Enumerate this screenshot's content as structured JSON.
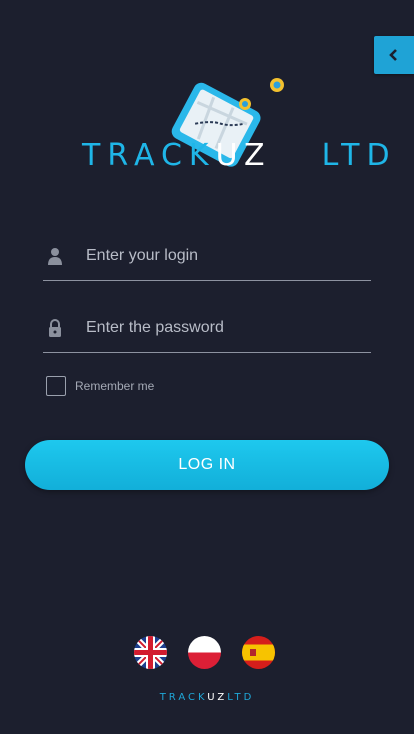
{
  "brand": {
    "logo_part1": "TRACK",
    "logo_part2": "UZ",
    "logo_part3": "LTD",
    "colors": {
      "background": "#1c1f2e",
      "accent": "#1fb6e8",
      "button": "#18bde6"
    }
  },
  "sidebar_toggle": {
    "icon": "chevron-left-icon"
  },
  "form": {
    "login_placeholder": "Enter your login",
    "password_placeholder": "Enter the password",
    "login_icon": "user-icon",
    "password_icon": "lock-icon",
    "remember_label": "Remember me",
    "remember_checked": false,
    "submit_label": "LOG IN"
  },
  "languages": [
    {
      "code": "en",
      "icon": "uk-flag-icon"
    },
    {
      "code": "pl",
      "icon": "poland-flag-icon"
    },
    {
      "code": "es",
      "icon": "spain-flag-icon"
    }
  ]
}
